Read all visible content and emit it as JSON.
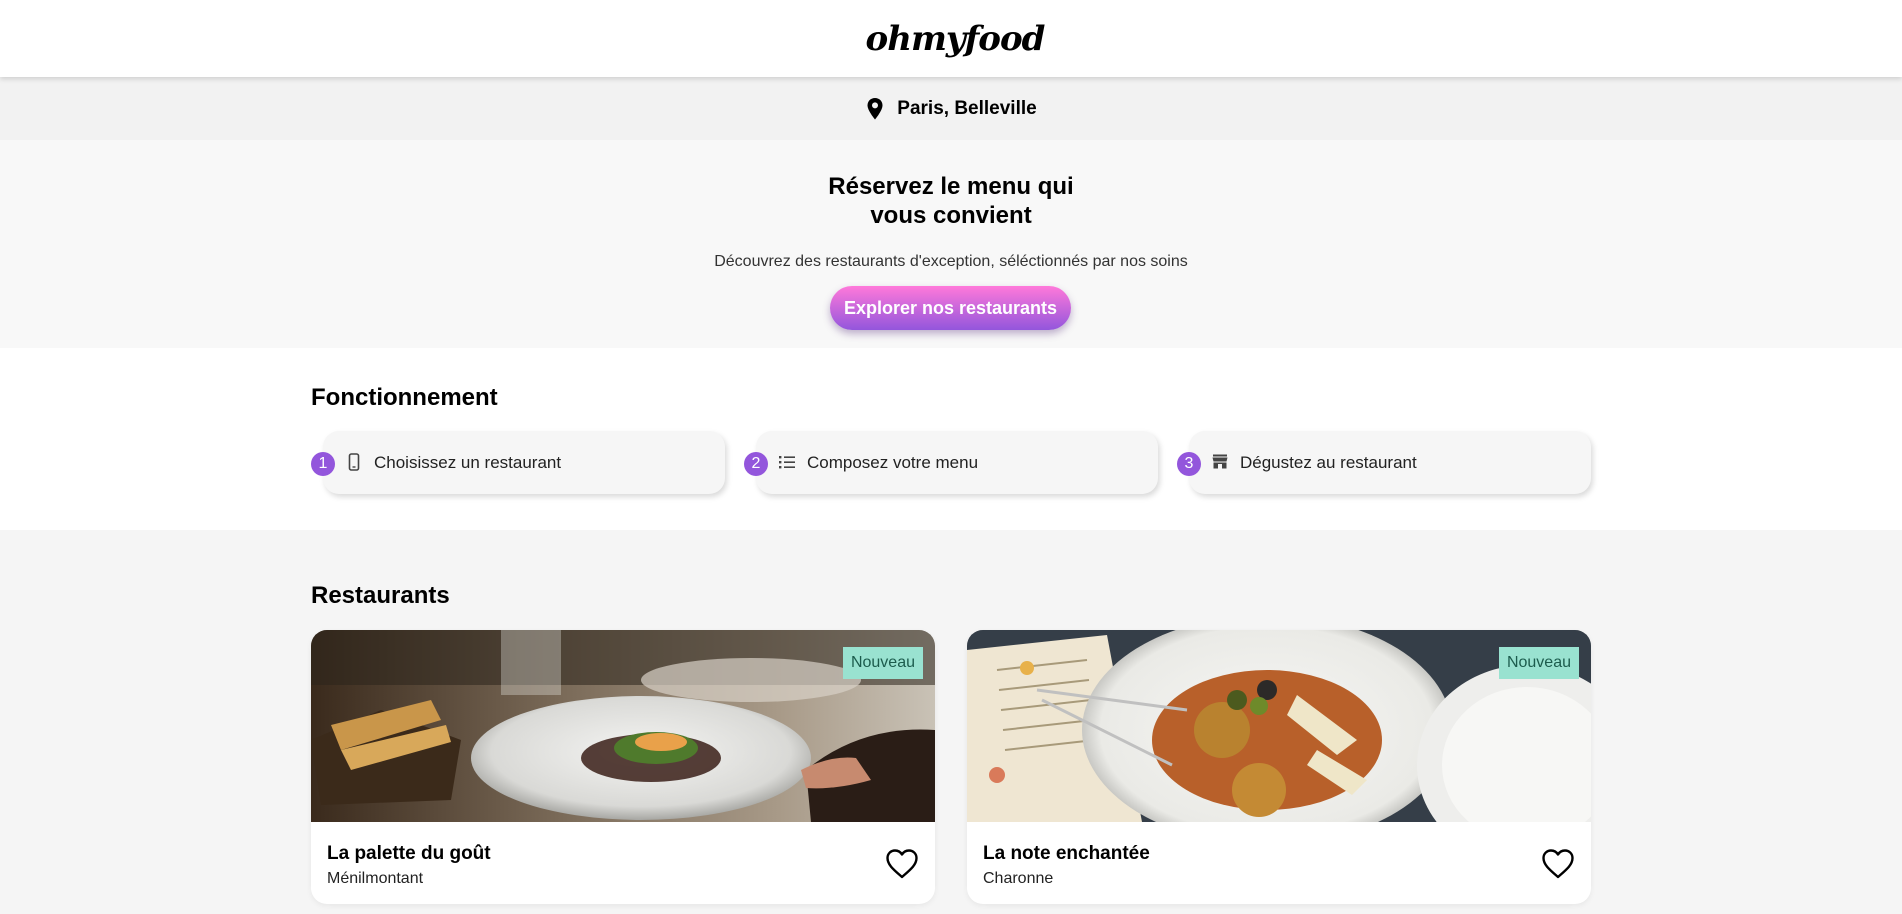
{
  "header": {
    "logo": "ohmyfood"
  },
  "location": {
    "label": "Paris, Belleville",
    "icon": "map-pin-icon"
  },
  "hero": {
    "title_line1": "Réservez le menu qui",
    "title_line2": "vous convient",
    "subtitle": "Découvrez des restaurants d'exception, séléctionnés par nos soins",
    "cta_label": "Explorer nos restaurants"
  },
  "how": {
    "title": "Fonctionnement",
    "steps": [
      {
        "number": "1",
        "label": "Choisissez un restaurant",
        "icon": "smartphone-icon"
      },
      {
        "number": "2",
        "label": "Composez votre menu",
        "icon": "list-icon"
      },
      {
        "number": "3",
        "label": "Dégustez au restaurant",
        "icon": "store-icon"
      }
    ]
  },
  "restaurants": {
    "title": "Restaurants",
    "items": [
      {
        "name": "La palette du goût",
        "area": "Ménilmontant",
        "badge": "Nouveau"
      },
      {
        "name": "La note enchantée",
        "area": "Charonne",
        "badge": "Nouveau"
      }
    ]
  },
  "colors": {
    "accent": "#9356dc",
    "cta_gradient_start": "#ff79da",
    "badge_bg": "#99e2d0"
  }
}
